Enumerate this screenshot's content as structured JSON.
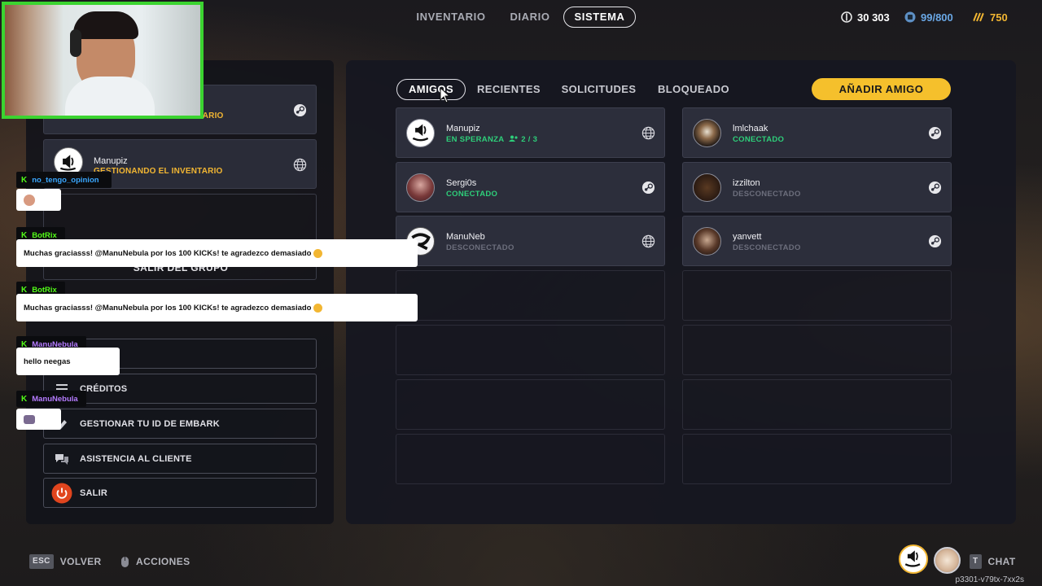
{
  "topnav": {
    "tabs": [
      {
        "label": "INVENTARIO",
        "active": false
      },
      {
        "label": "DIARIO",
        "active": false
      },
      {
        "label": "SISTEMA",
        "active": true
      }
    ]
  },
  "currencies": [
    {
      "icon": "coin-icon",
      "value": "30 303",
      "color": "#ffffff"
    },
    {
      "icon": "storage-icon",
      "value": "99/800",
      "color": "#6aa8e6"
    },
    {
      "icon": "tickets-icon",
      "value": "750",
      "color": "#f2b632"
    }
  ],
  "party": {
    "member1": {
      "status": "GESTIONANDO EL INVENTARIO",
      "platform_icon": "steam-icon"
    },
    "member2": {
      "name": "Manupiz",
      "status": "GESTIONANDO EL INVENTARIO",
      "platform_icon": "globe-icon"
    },
    "leave_label": "SALIR DEL GRUPO"
  },
  "system_menu": {
    "credits_label": "CRÉDITOS",
    "embark_label": "GESTIONAR TU ID DE EMBARK",
    "support_label": "ASISTENCIA AL CLIENTE",
    "exit_label": "SALIR"
  },
  "friends": {
    "tabs": [
      {
        "label": "AMIGOS",
        "active": true
      },
      {
        "label": "RECIENTES",
        "active": false
      },
      {
        "label": "SOLICITUDES",
        "active": false
      },
      {
        "label": "BLOQUEADO",
        "active": false
      }
    ],
    "add_label": "AÑADIR AMIGO",
    "left_column": [
      {
        "name": "Manupiz",
        "status": "EN SPERANZA",
        "party": "2 / 3",
        "state": "wait",
        "platform_icon": "globe-icon"
      },
      {
        "name": "Sergi0s",
        "status": "CONECTADO",
        "state": "on",
        "platform_icon": "steam-icon"
      },
      {
        "name": "ManuNeb",
        "status": "DESCONECTADO",
        "state": "off",
        "platform_icon": "globe-icon"
      }
    ],
    "right_column": [
      {
        "name": "lmlchaak",
        "status": "CONECTADO",
        "state": "on",
        "platform_icon": "steam-icon"
      },
      {
        "name": "izzilton",
        "status": "DESCONECTADO",
        "state": "off",
        "platform_icon": "steam-icon"
      },
      {
        "name": "yanvett",
        "status": "DESCONECTADO",
        "state": "off",
        "platform_icon": "steam-icon"
      }
    ]
  },
  "chat_overlay": {
    "messages": [
      {
        "user": "no_tengo_opinion",
        "user_color": "#3aa7ff",
        "text": ""
      },
      {
        "user": "BotRix",
        "user_color": "#53fc18",
        "text": "Muchas graciasss! @ManuNebula por los 100 KICKs! te agradezco demasiado"
      },
      {
        "user": "BotRix",
        "user_color": "#53fc18",
        "text": "Muchas graciasss! @ManuNebula por los 100 KICKs! te agradezco demasiado"
      },
      {
        "user": "ManuNebula",
        "user_color": "#b57bff",
        "text": "hello neegas"
      },
      {
        "user": "ManuNebula",
        "user_color": "#b57bff",
        "text": ""
      }
    ]
  },
  "bottom": {
    "back_key": "ESC",
    "back_label": "VOLVER",
    "actions_label": "ACCIONES",
    "chat_key": "T",
    "chat_label": "CHAT",
    "version": "p3301-v79tx-7xx2s"
  }
}
